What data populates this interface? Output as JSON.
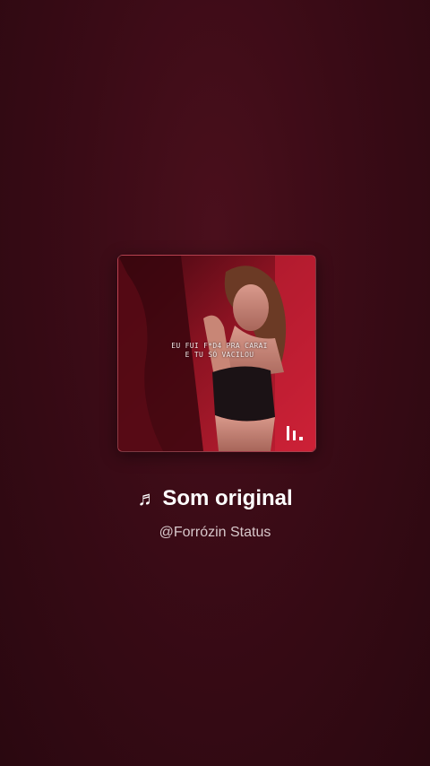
{
  "audio": {
    "note_icon": "music-note-icon",
    "note_glyph": "♬",
    "title": "Som original",
    "author": "@Forrózin Status"
  },
  "cover": {
    "caption_line1": "EU FUI F*D4 PRA CARAI",
    "caption_line2": "E TU SÓ VACILOU",
    "brand_icon": "bars-logo-icon"
  },
  "colors": {
    "background": "#3a0b16",
    "accent": "#b01a2c",
    "title_text": "#ffffff",
    "subtitle_text": "#d8c8cb"
  }
}
